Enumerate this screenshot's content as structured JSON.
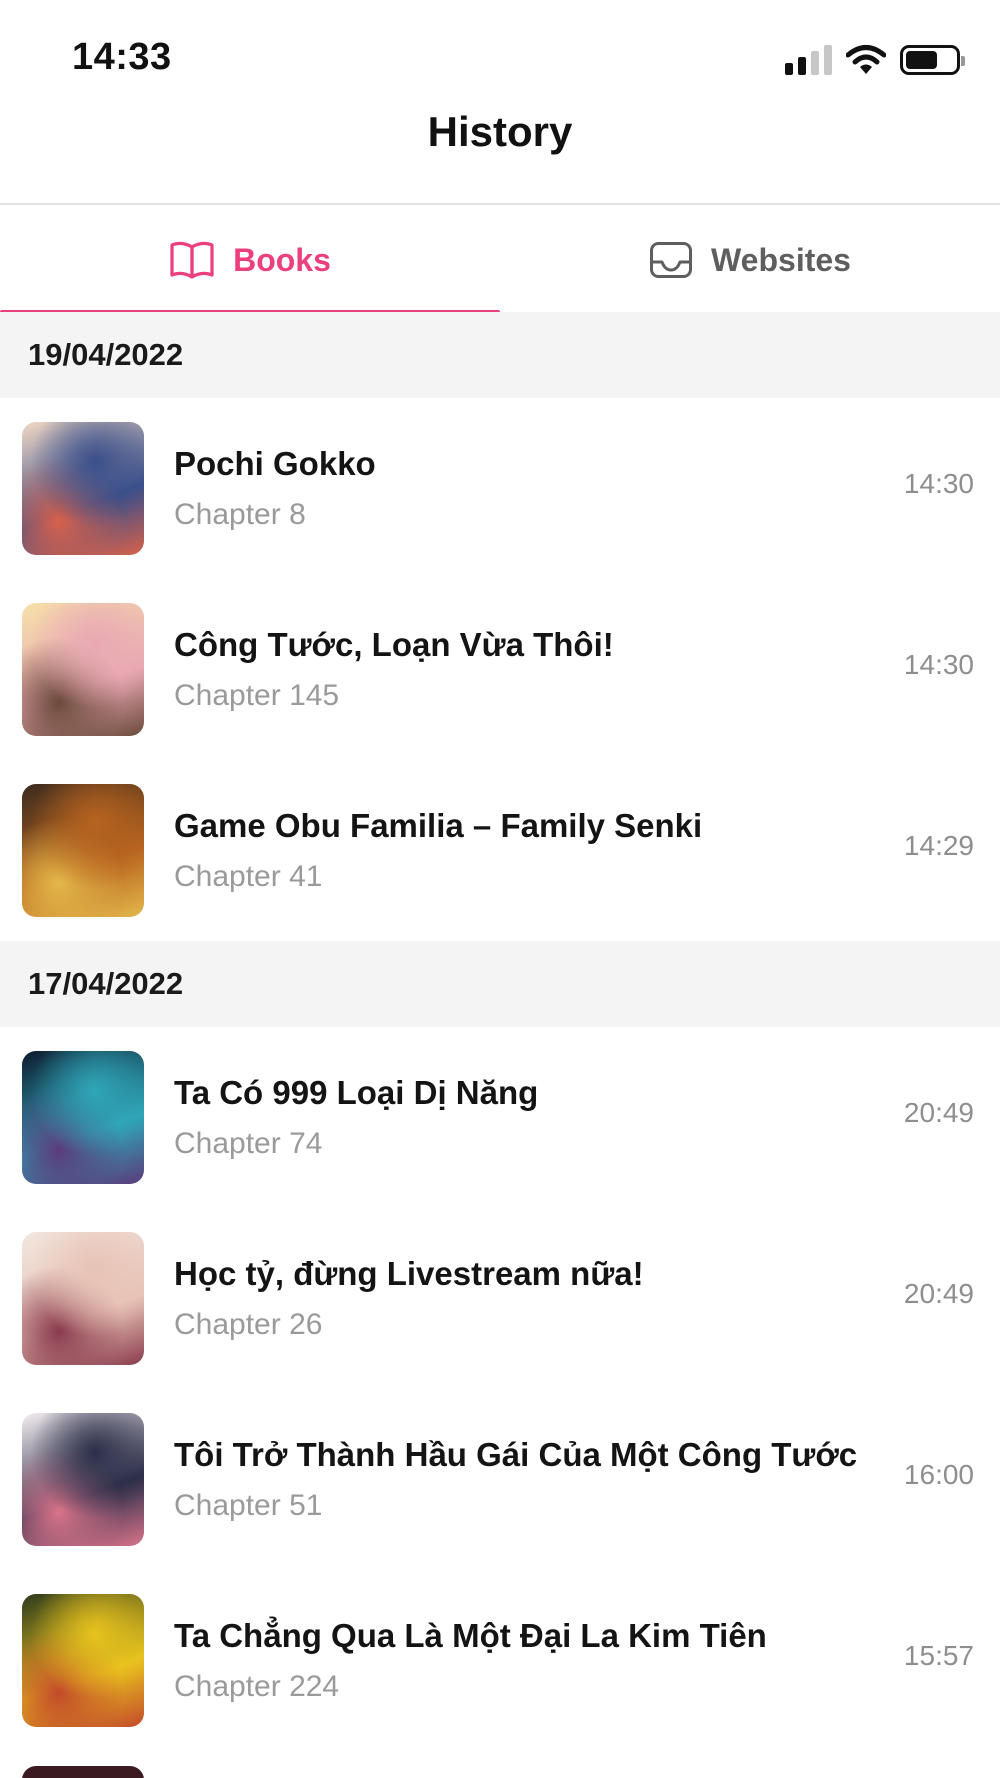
{
  "status_bar": {
    "time": "14:33",
    "battery_level": 0.65
  },
  "nav": {
    "title": "History"
  },
  "tabs": [
    {
      "label": "Books",
      "icon": "open-book-icon",
      "active": true
    },
    {
      "label": "Websites",
      "icon": "inbox-tray-icon",
      "active": false
    }
  ],
  "colors": {
    "accent": "#ec3f7e",
    "section_bg": "#f4f4f5",
    "subtitle": "#9a9a9a"
  },
  "groups": [
    {
      "date": "19/04/2022",
      "items": [
        {
          "title": "Pochi Gokko",
          "chapter": "Chapter 8",
          "time": "14:30",
          "cover_colors": [
            "#f2d9c4",
            "#3a4f8a",
            "#d8614a"
          ]
        },
        {
          "title": "Công Tước, Loạn Vừa Thôi!",
          "chapter": "Chapter 145",
          "time": "14:30",
          "cover_colors": [
            "#f6e1a8",
            "#e9a8b4",
            "#6b4a3a"
          ]
        },
        {
          "title": "Game Obu Familia – Family Senki",
          "chapter": "Chapter 41",
          "time": "14:29",
          "cover_colors": [
            "#3a2a1e",
            "#b8641f",
            "#e3b84a"
          ]
        }
      ]
    },
    {
      "date": "17/04/2022",
      "items": [
        {
          "title": "Ta Có 999 Loại Dị Năng",
          "chapter": "Chapter 74",
          "time": "20:49",
          "cover_colors": [
            "#0e1a2e",
            "#2fa6b8",
            "#5b3a7a"
          ]
        },
        {
          "title": "Học tỷ, đừng Livestream nữa!",
          "chapter": "Chapter 26",
          "time": "20:49",
          "cover_colors": [
            "#f1e6df",
            "#e8c3b6",
            "#8a3b4e"
          ]
        },
        {
          "title": "Tôi Trở Thành Hầu Gái Của Một Công Tước",
          "chapter": "Chapter 51",
          "time": "16:00",
          "cover_colors": [
            "#f4eef0",
            "#2d2f4a",
            "#d9748a"
          ]
        },
        {
          "title": "Ta Chẳng Qua Là Một Đại La Kim Tiên",
          "chapter": "Chapter 224",
          "time": "15:57",
          "cover_colors": [
            "#2c3a1c",
            "#e8c31e",
            "#c24a2a"
          ]
        }
      ]
    }
  ]
}
